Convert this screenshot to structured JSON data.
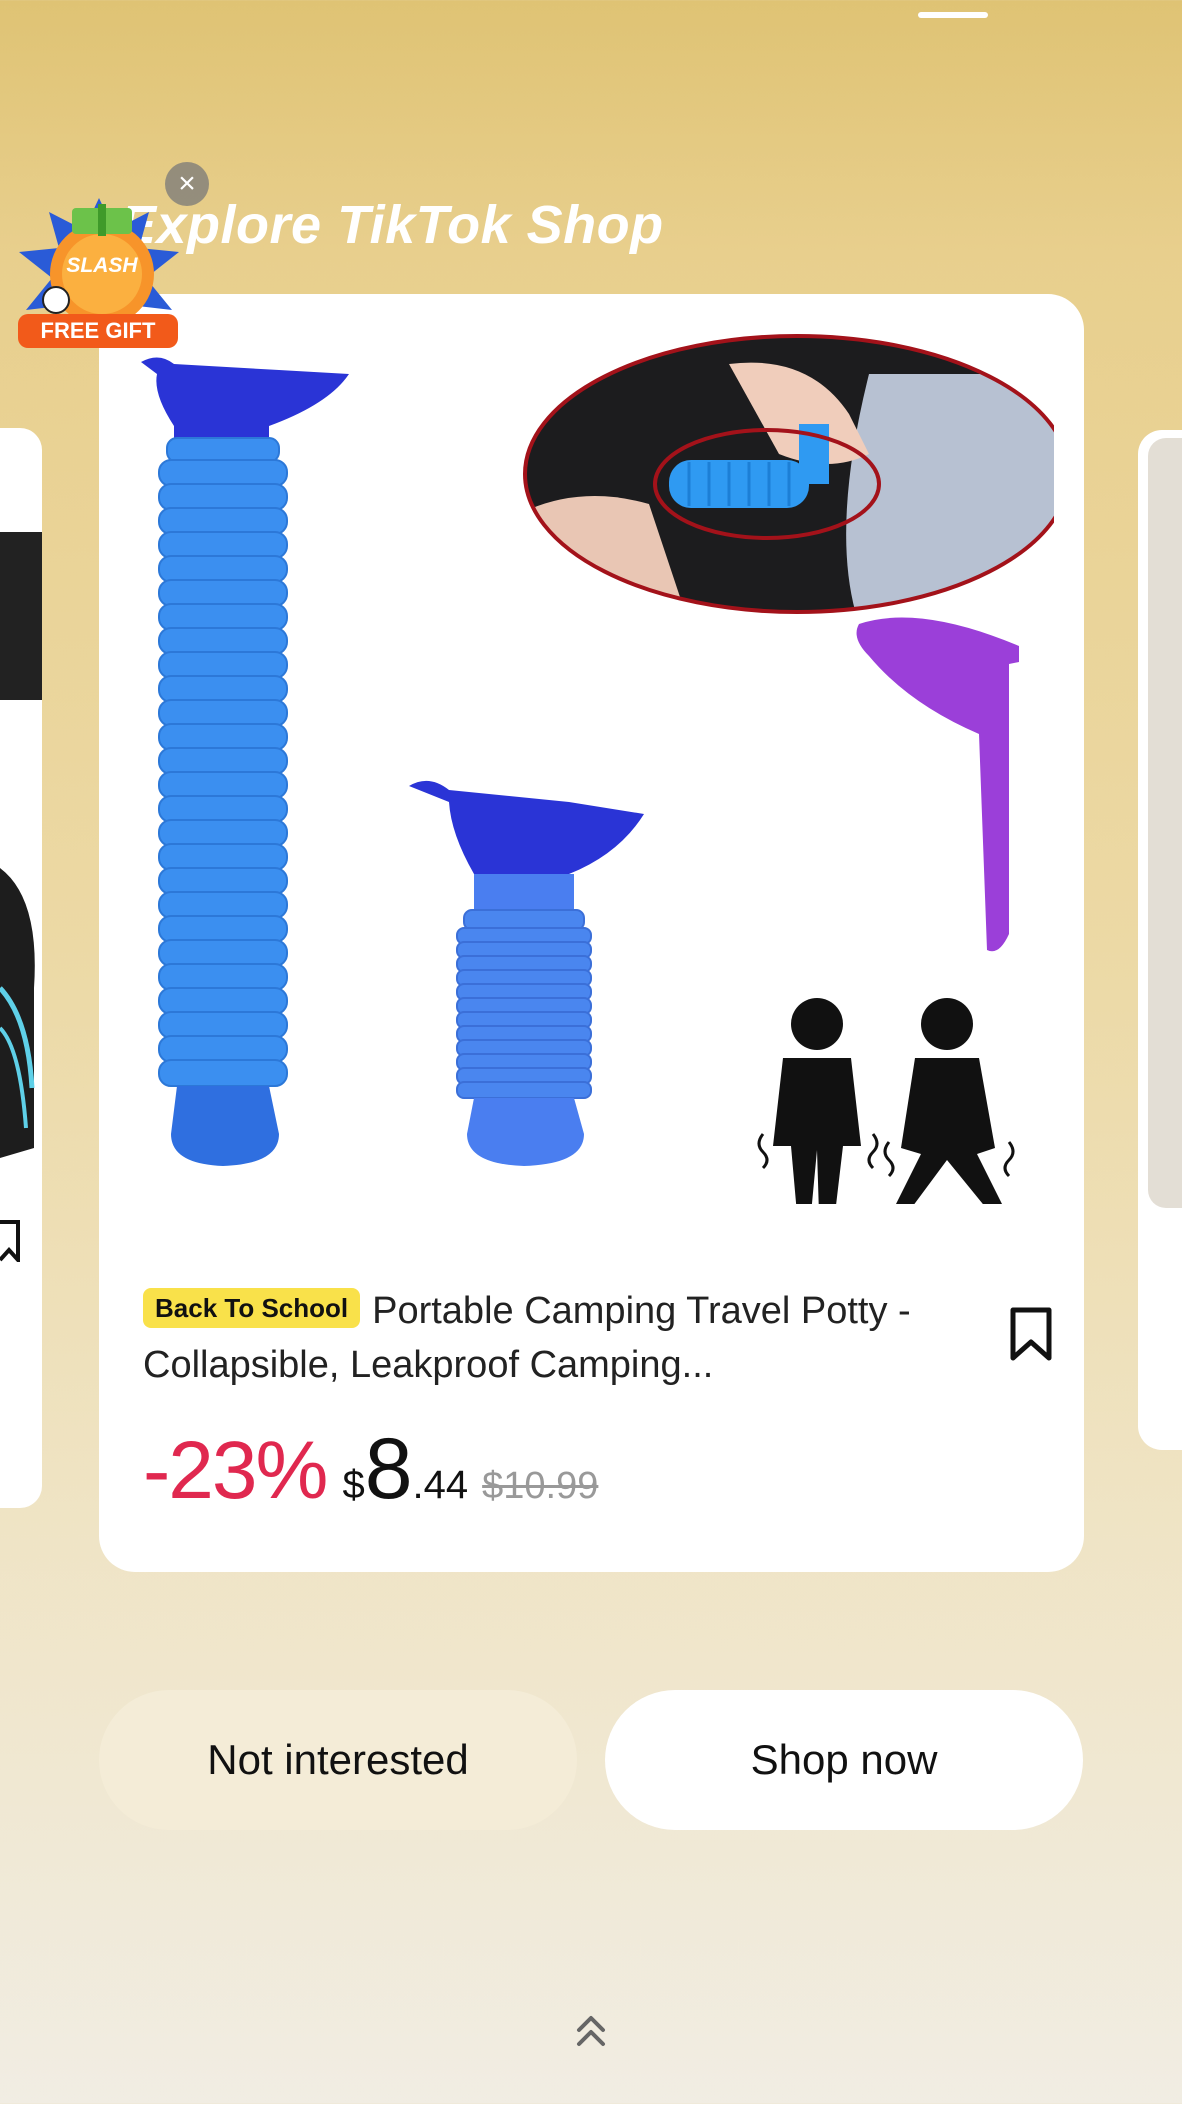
{
  "header": {
    "title": "Explore TikTok Shop",
    "close_glyph": "×"
  },
  "promo": {
    "top_text": "SLASH",
    "bottom_text": "FREE GIFT"
  },
  "product": {
    "tag": "Back To School",
    "title": "Portable Camping Travel Potty - Collapsible, Leakproof Camping...",
    "discount": "-23%",
    "currency": "$",
    "price_int": "8",
    "price_dec": ".44",
    "original_price": "$10.99"
  },
  "actions": {
    "not_interested": "Not interested",
    "shop_now": "Shop now"
  },
  "colors": {
    "discount": "#e0284f",
    "tag_bg": "#f9e14a",
    "product_blue": "#3b8ff0",
    "cap_blue": "#2a34d6",
    "funnel_purple": "#9b3fd9"
  },
  "icons": [
    "close-icon",
    "bookmark-icon",
    "swipe-up-icon"
  ]
}
